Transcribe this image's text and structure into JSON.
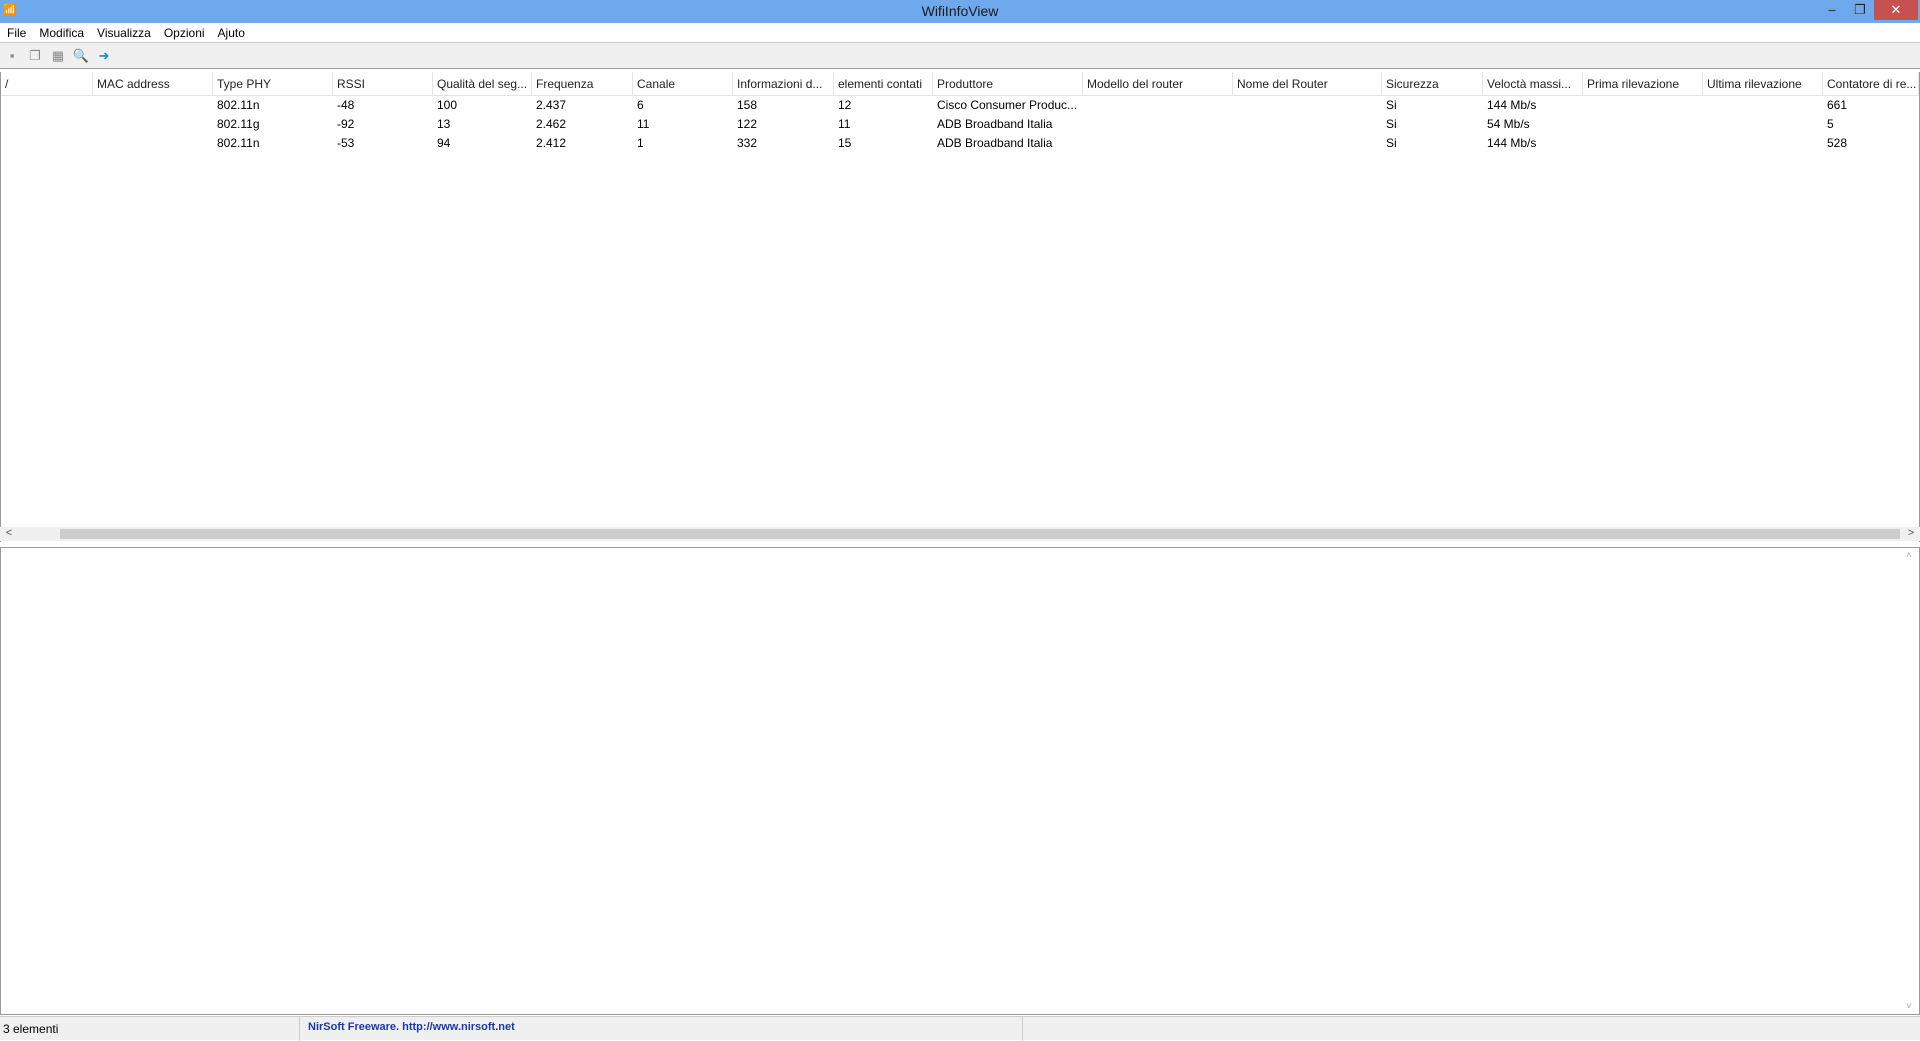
{
  "window": {
    "title": "WifiInfoView",
    "minimize": "–",
    "restore": "❐",
    "close": "✕"
  },
  "menu": [
    "File",
    "Modifica",
    "Visualizza",
    "Opzioni",
    "Ajuto"
  ],
  "toolbar": [
    {
      "icon": "save-icon",
      "glyph": "▪"
    },
    {
      "icon": "copy-icon",
      "glyph": "❐"
    },
    {
      "icon": "properties-icon",
      "glyph": "▦"
    },
    {
      "icon": "find-icon",
      "glyph": "🔍"
    },
    {
      "icon": "exit-icon",
      "glyph": "➜"
    }
  ],
  "table": {
    "columns": [
      "/",
      "MAC address",
      "Type PHY",
      "RSSI",
      "Qualità del seg...",
      "Frequenza",
      "Canale",
      "Informazioni d...",
      "elementi contati",
      "Produttore",
      "Modello del router",
      "Nome del Router",
      "Sicurezza",
      "Veloctà massi...",
      "Prima rilevazione",
      "Ultima rilevazione",
      "Contatore di re..."
    ],
    "rows": [
      [
        "",
        "",
        "802.11n",
        "-48",
        "100",
        "2.437",
        "6",
        "158",
        "12",
        "Cisco Consumer Produc...",
        "",
        "",
        "Si",
        "144 Mb/s",
        "",
        "",
        "661"
      ],
      [
        "",
        "",
        "802.11g",
        "-92",
        "13",
        "2.462",
        "11",
        "122",
        "11",
        "ADB Broadband Italia",
        "",
        "",
        "Si",
        "54 Mb/s",
        "",
        "",
        "5"
      ],
      [
        "",
        "",
        "802.11n",
        "-53",
        "94",
        "2.412",
        "1",
        "332",
        "15",
        "ADB Broadband Italia",
        "",
        "",
        "Si",
        "144 Mb/s",
        "",
        "",
        "528"
      ]
    ]
  },
  "status": {
    "count": "3 elementi",
    "credit": "NirSoft Freeware.  http://www.nirsoft.net"
  }
}
